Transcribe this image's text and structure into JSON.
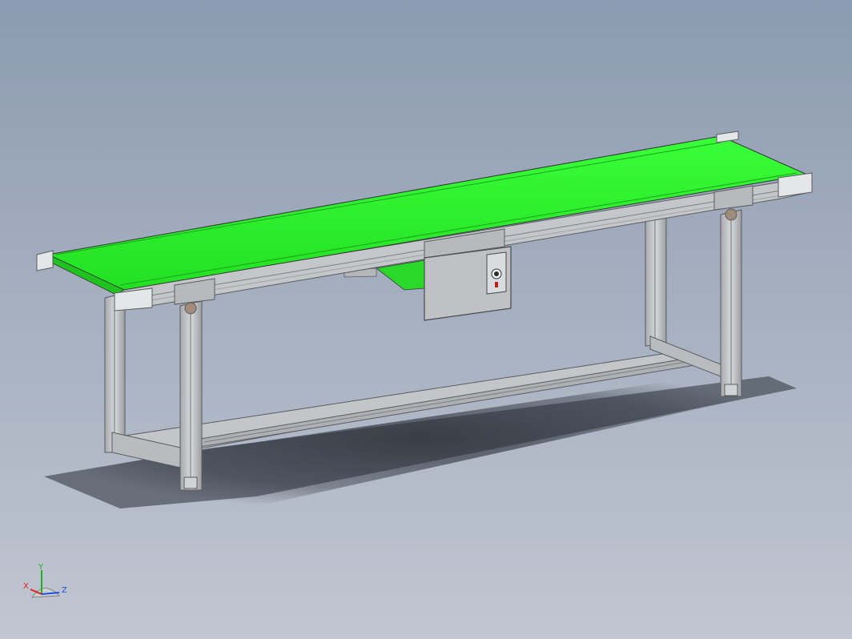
{
  "viewport": {
    "background_top": "#8c9bb1",
    "background_bottom": "#c1c6d1"
  },
  "model": {
    "belt_color": "#2ef52e",
    "belt_dark": "#1bb81b",
    "frame_color": "#c9cbcf",
    "frame_shadow": "#8d9095",
    "control_box_color": "#bfc1c4"
  },
  "triad": {
    "x_label": "X",
    "y_label": "Y",
    "z_label": "Z",
    "x_color": "#e02020",
    "y_color": "#20b020",
    "z_color": "#2050e0"
  }
}
